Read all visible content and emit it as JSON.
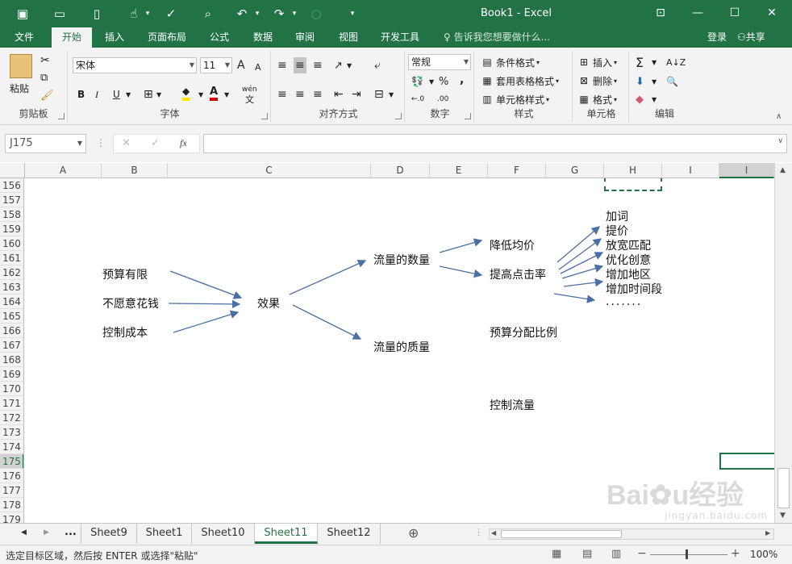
{
  "window": {
    "title": "Book1 - Excel",
    "controls": [
      "restore-ribbon",
      "minimize",
      "maximize",
      "close"
    ]
  },
  "ribbon_tabs": [
    "文件",
    "开始",
    "插入",
    "页面布局",
    "公式",
    "数据",
    "审阅",
    "视图",
    "开发工具"
  ],
  "active_tab": "开始",
  "tell_me": "告诉我您想要做什么...",
  "account": {
    "login": "登录",
    "share": "共享"
  },
  "groups": {
    "clipboard": {
      "label": "剪贴板",
      "paste": "粘贴"
    },
    "font": {
      "label": "字体",
      "font_name": "宋体",
      "font_size": "11",
      "grow": "A",
      "shrink": "A",
      "bold": "B",
      "italic": "I",
      "underline": "U",
      "wen": "wén",
      "wen_char": "文",
      "fill_glyph": "◆",
      "color_glyph": "A"
    },
    "alignment": {
      "label": "对齐方式"
    },
    "number": {
      "label": "数字",
      "format": "常规",
      "percent": "%",
      "comma": ",",
      "inc": "←.0",
      "dec": ".00"
    },
    "styles": {
      "label": "样式",
      "conditional": "条件格式",
      "table": "套用表格格式",
      "cell_styles": "单元格样式"
    },
    "cells": {
      "label": "单元格",
      "insert": "插入",
      "delete": "删除",
      "format": "格式"
    },
    "editing": {
      "label": "编辑",
      "sum": "Σ",
      "sort": "A↓Z",
      "find": "🔍"
    }
  },
  "name_box": "J175",
  "formula_buttons": {
    "cancel": "✕",
    "enter": "✓",
    "fx": "fx"
  },
  "columns": [
    "A",
    "B",
    "C",
    "D",
    "E",
    "F",
    "G",
    "H",
    "I"
  ],
  "selected_column": "I",
  "rows": [
    "156",
    "157",
    "158",
    "159",
    "160",
    "161",
    "162",
    "163",
    "164",
    "165",
    "166",
    "167",
    "168",
    "169",
    "170",
    "171",
    "172",
    "173",
    "174",
    "175",
    "176",
    "177",
    "178",
    "179"
  ],
  "selected_row": "175",
  "diagram": {
    "inputs": [
      "预算有限",
      "不愿意花钱",
      "控制成本"
    ],
    "center": "效果",
    "quantity": "流量的数量",
    "quality": "流量的质量",
    "reduce_cpc": "降低均价",
    "raise_ctr": "提高点击率",
    "actions": [
      "加词",
      "提价",
      "放宽匹配",
      "优化创意",
      "增加地区",
      "增加时间段",
      "......."
    ],
    "budget_ratio": "预算分配比例",
    "control_traffic": "控制流量"
  },
  "sheet_tabs": [
    "Sheet9",
    "Sheet1",
    "Sheet10",
    "Sheet11",
    "Sheet12"
  ],
  "active_sheet": "Sheet11",
  "tab_nav": {
    "prev": "◀",
    "next": "▶",
    "more": "..."
  },
  "status_text": "选定目标区域，然后按 ENTER 或选择\"粘贴\"",
  "zoom": "100%",
  "watermark": "Baidu经验 jingyan.baidu.com"
}
